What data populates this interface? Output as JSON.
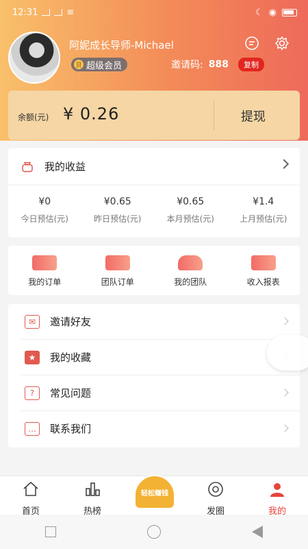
{
  "status_bar": {
    "time": "12:31"
  },
  "profile": {
    "username": "阿妮成长导师-Michael",
    "vip_label": "超级会员",
    "vip_icon_text": "贝",
    "invite_label": "邀请码:",
    "invite_code": "888",
    "copy_label": "复制"
  },
  "balance": {
    "label": "余额(元)",
    "value": "¥ 0.26",
    "withdraw_label": "提现"
  },
  "income": {
    "title": "我的收益",
    "stats": [
      {
        "value": "¥0",
        "label": "今日预估(元)"
      },
      {
        "value": "¥0.65",
        "label": "昨日预估(元)"
      },
      {
        "value": "¥0.65",
        "label": "本月预估(元)"
      },
      {
        "value": "¥1.4",
        "label": "上月预估(元)"
      }
    ]
  },
  "shortcuts": [
    {
      "label": "我的订单",
      "icon": "order-icon"
    },
    {
      "label": "团队订单",
      "icon": "team-order-icon"
    },
    {
      "label": "我的团队",
      "icon": "team-icon"
    },
    {
      "label": "收入报表",
      "icon": "report-icon"
    }
  ],
  "menu": [
    {
      "label": "邀请好友",
      "icon": "invite-icon",
      "glyph": "✉"
    },
    {
      "label": "我的收藏",
      "icon": "favorite-icon",
      "glyph": "★"
    },
    {
      "label": "常见问题",
      "icon": "faq-icon",
      "glyph": "?"
    },
    {
      "label": "联系我们",
      "icon": "contact-icon",
      "glyph": "…"
    }
  ],
  "tabbar": {
    "items": [
      {
        "label": "首页",
        "icon": "home-icon"
      },
      {
        "label": "热榜",
        "icon": "chart-icon"
      },
      {
        "label": "",
        "icon": "promo-icon"
      },
      {
        "label": "发圈",
        "icon": "camera-icon"
      },
      {
        "label": "我的",
        "icon": "user-icon"
      }
    ],
    "promo_text": "轻松赚钱"
  },
  "colors": {
    "accent": "#e6453c",
    "header_start": "#f9c06a",
    "header_end": "#ee6a5a",
    "balance_card": "#f5d6a4"
  }
}
